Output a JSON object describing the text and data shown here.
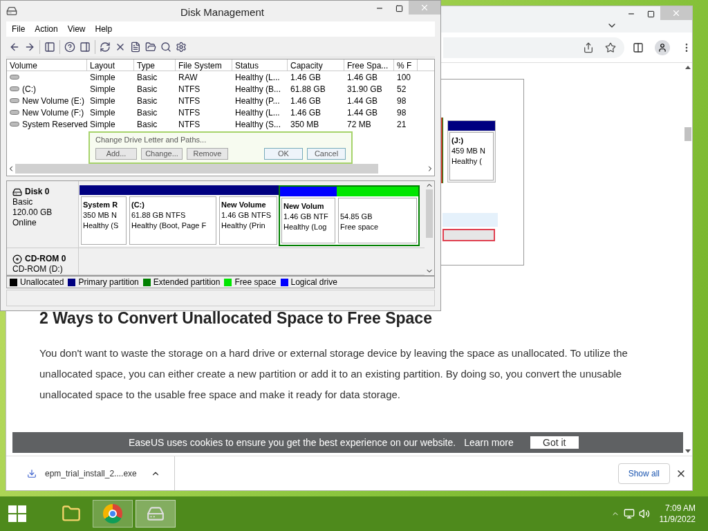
{
  "disk_management": {
    "title": "Disk Management",
    "menu": [
      "File",
      "Action",
      "View",
      "Help"
    ],
    "columns": [
      "Volume",
      "Layout",
      "Type",
      "File System",
      "Status",
      "Capacity",
      "Free Spa...",
      "% F"
    ],
    "rows": [
      {
        "cells": [
          "",
          "Simple",
          "Basic",
          "RAW",
          "Healthy (L...",
          "1.46 GB",
          "1.46 GB",
          "100"
        ]
      },
      {
        "cells": [
          "(C:)",
          "Simple",
          "Basic",
          "NTFS",
          "Healthy (B...",
          "61.88 GB",
          "31.90 GB",
          "52"
        ]
      },
      {
        "cells": [
          "New Volume (E:)",
          "Simple",
          "Basic",
          "NTFS",
          "Healthy (P...",
          "1.46 GB",
          "1.44 GB",
          "98"
        ]
      },
      {
        "cells": [
          "New Volume (F:)",
          "Simple",
          "Basic",
          "NTFS",
          "Healthy (L...",
          "1.46 GB",
          "1.44 GB",
          "98"
        ]
      },
      {
        "cells": [
          "System Reserved",
          "Simple",
          "Basic",
          "NTFS",
          "Healthy (S...",
          "350 MB",
          "72 MB",
          "21"
        ]
      }
    ],
    "disks": [
      {
        "kind": "disk",
        "name": "Disk 0",
        "lines": [
          "Basic",
          "120.00 GB",
          "Online"
        ],
        "partitions": [
          {
            "name": "System R",
            "size": "350 MB N",
            "status": "Healthy (S",
            "color": "#000080"
          },
          {
            "name": "(C:)",
            "size": "61.88 GB NTFS",
            "status": "Healthy (Boot, Page F",
            "color": "#000080"
          },
          {
            "name": "New Volume",
            "size": "1.46 GB NTFS",
            "status": "Healthy (Prin",
            "color": "#000080"
          },
          {
            "name": "New Volum",
            "size": "1.46 GB NTF",
            "status": "Healthy (Log",
            "color": "#0000ff"
          },
          {
            "size": "54.85 GB",
            "status": "Free space",
            "color": "#00e600"
          }
        ]
      },
      {
        "kind": "cdrom",
        "name": "CD-ROM 0",
        "lines": [
          "CD-ROM (D:)"
        ]
      }
    ],
    "ghost_dialog": {
      "title": "Change Drive Letter and Paths...",
      "buttons": [
        "Add...",
        "Change...",
        "Remove"
      ],
      "footer_buttons": [
        "OK",
        "Cancel"
      ]
    },
    "legend": [
      {
        "label": "Unallocated",
        "color": "#000000"
      },
      {
        "label": "Primary partition",
        "color": "#000080"
      },
      {
        "label": "Extended partition",
        "color": "#008000"
      },
      {
        "label": "Free space",
        "color": "#00e600"
      },
      {
        "label": "Logical drive",
        "color": "#0000ff"
      }
    ]
  },
  "browser": {
    "embedded_screenshot": {
      "name": "(J:)",
      "size": "459 MB N",
      "status": "Healthy ("
    },
    "heading": "2 Ways to Convert Unallocated Space to Free Space",
    "paragraph": "You don't want to waste the storage on a hard drive or external storage device by leaving the space as unallocated. To utilize the unallocated space, you can either create a new partition or add it to an existing partition. By doing so, you convert the unusable unallocated space to the usable free space and make it ready for data storage.",
    "cookie_bar": {
      "text": "EaseUS uses cookies to ensure you get the best experience on our website.",
      "link": "Learn more",
      "button": "Got it"
    },
    "download": {
      "file": "epm_trial_install_2....exe",
      "show_all": "Show all"
    }
  },
  "taskbar": {
    "time": "7:09 AM",
    "date": "11/9/2022"
  }
}
